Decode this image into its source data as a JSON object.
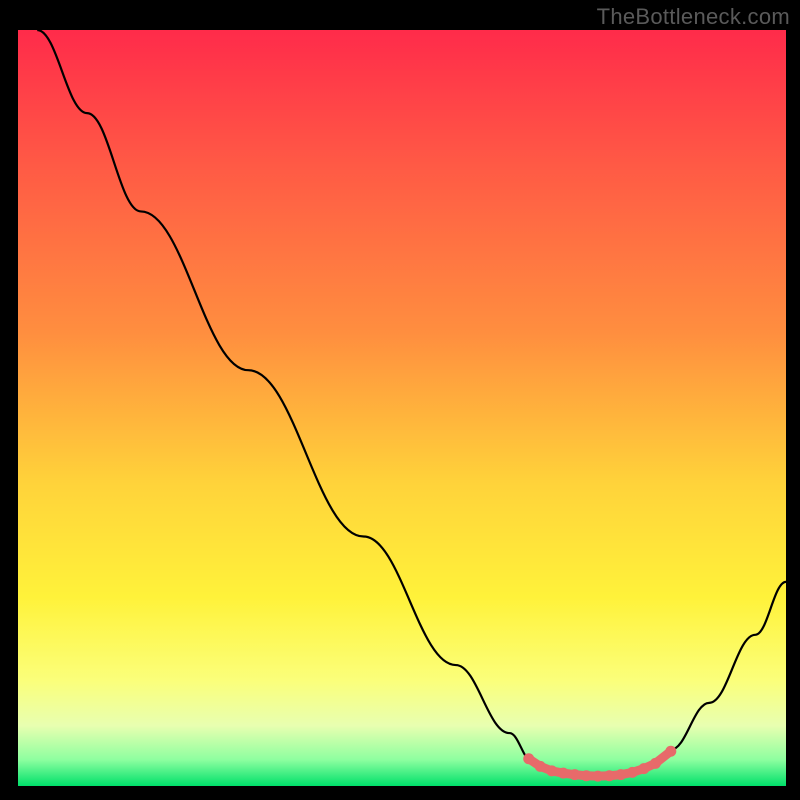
{
  "attribution": "TheBottleneck.com",
  "chart_data": {
    "type": "line",
    "title": "",
    "xlabel": "",
    "ylabel": "",
    "xlim": [
      0,
      100
    ],
    "ylim": [
      0,
      100
    ],
    "gradient_stops": [
      {
        "offset": 0,
        "color": "#ff2b4a"
      },
      {
        "offset": 0.18,
        "color": "#ff5a45"
      },
      {
        "offset": 0.4,
        "color": "#ff8e3f"
      },
      {
        "offset": 0.6,
        "color": "#ffd33a"
      },
      {
        "offset": 0.75,
        "color": "#fff23a"
      },
      {
        "offset": 0.86,
        "color": "#fbff7a"
      },
      {
        "offset": 0.92,
        "color": "#e8ffb0"
      },
      {
        "offset": 0.965,
        "color": "#8effa0"
      },
      {
        "offset": 1.0,
        "color": "#00e06a"
      }
    ],
    "series": [
      {
        "name": "bottleneck-curve",
        "stroke": "#000000",
        "stroke_width": 2.2,
        "points": [
          {
            "x": 2.5,
            "y": 100
          },
          {
            "x": 9,
            "y": 89
          },
          {
            "x": 16,
            "y": 76
          },
          {
            "x": 30,
            "y": 55
          },
          {
            "x": 45,
            "y": 33
          },
          {
            "x": 57,
            "y": 16
          },
          {
            "x": 64,
            "y": 7
          },
          {
            "x": 67,
            "y": 3.2
          },
          {
            "x": 70,
            "y": 1.8
          },
          {
            "x": 73,
            "y": 1.4
          },
          {
            "x": 76,
            "y": 1.3
          },
          {
            "x": 79,
            "y": 1.6
          },
          {
            "x": 82,
            "y": 2.5
          },
          {
            "x": 85,
            "y": 4.8
          },
          {
            "x": 90,
            "y": 11
          },
          {
            "x": 96,
            "y": 20
          },
          {
            "x": 100,
            "y": 27
          }
        ]
      },
      {
        "name": "sweet-spot-markers",
        "stroke": "#e76a6a",
        "stroke_width": 9,
        "marker_radius": 5.5,
        "points": [
          {
            "x": 66.5,
            "y": 3.6
          },
          {
            "x": 68,
            "y": 2.6
          },
          {
            "x": 69.5,
            "y": 2.0
          },
          {
            "x": 71,
            "y": 1.7
          },
          {
            "x": 72.5,
            "y": 1.5
          },
          {
            "x": 74,
            "y": 1.35
          },
          {
            "x": 75.5,
            "y": 1.3
          },
          {
            "x": 77,
            "y": 1.35
          },
          {
            "x": 78.5,
            "y": 1.5
          },
          {
            "x": 80,
            "y": 1.8
          },
          {
            "x": 81.5,
            "y": 2.3
          },
          {
            "x": 83,
            "y": 3.0
          },
          {
            "x": 85,
            "y": 4.6
          }
        ]
      }
    ]
  }
}
